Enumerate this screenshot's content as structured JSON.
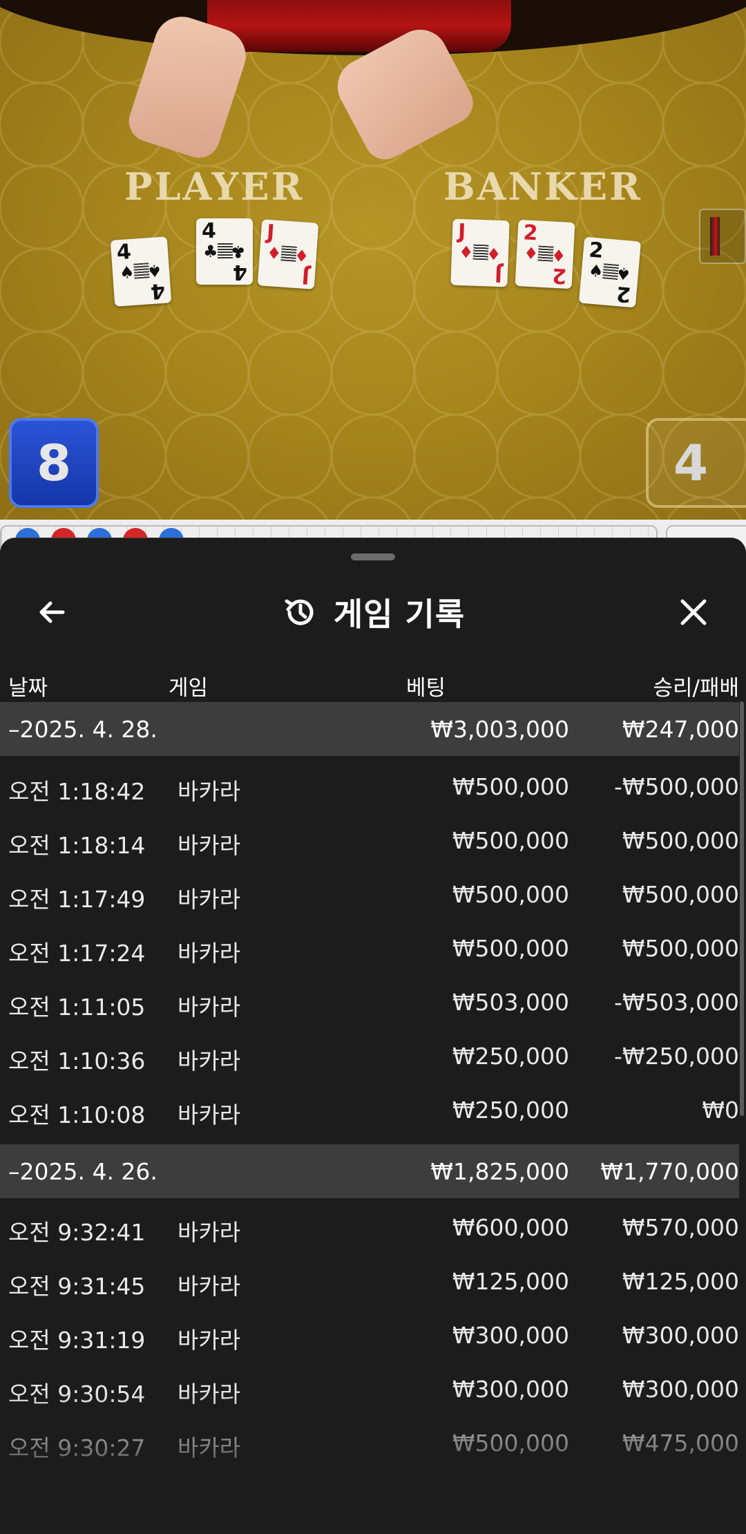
{
  "game_view": {
    "player_label": "PLAYER",
    "banker_label": "BANKER",
    "player_score": "8",
    "banker_score": "4",
    "player_cards": [
      {
        "rank": "4",
        "suit": "♠",
        "color": "black"
      },
      {
        "rank": "4",
        "suit": "♣",
        "color": "black"
      },
      {
        "rank": "J",
        "suit": "♦",
        "color": "red"
      }
    ],
    "banker_cards": [
      {
        "rank": "J",
        "suit": "♦",
        "color": "red"
      },
      {
        "rank": "2",
        "suit": "♦",
        "color": "red"
      },
      {
        "rank": "2",
        "suit": "♠",
        "color": "black"
      }
    ]
  },
  "sheet": {
    "title": "게임 기록",
    "title_icon": "history-icon",
    "back_icon": "arrow-left-icon",
    "close_icon": "close-icon",
    "columns": {
      "date": "날짜",
      "game": "게임",
      "bet": "베팅",
      "result": "승리/패배"
    },
    "groups": [
      {
        "date": "–2025. 4. 28.",
        "bet": "₩3,003,000",
        "result": "₩247,000",
        "rows": [
          {
            "time": "오전 1:18:42",
            "game": "바카라",
            "bet": "₩500,000",
            "result": "-₩500,000"
          },
          {
            "time": "오전 1:18:14",
            "game": "바카라",
            "bet": "₩500,000",
            "result": "₩500,000"
          },
          {
            "time": "오전 1:17:49",
            "game": "바카라",
            "bet": "₩500,000",
            "result": "₩500,000"
          },
          {
            "time": "오전 1:17:24",
            "game": "바카라",
            "bet": "₩500,000",
            "result": "₩500,000"
          },
          {
            "time": "오전 1:11:05",
            "game": "바카라",
            "bet": "₩503,000",
            "result": "-₩503,000"
          },
          {
            "time": "오전 1:10:36",
            "game": "바카라",
            "bet": "₩250,000",
            "result": "-₩250,000"
          },
          {
            "time": "오전 1:10:08",
            "game": "바카라",
            "bet": "₩250,000",
            "result": "₩0"
          }
        ]
      },
      {
        "date": "–2025. 4. 26.",
        "bet": "₩1,825,000",
        "result": "₩1,770,000",
        "rows": [
          {
            "time": "오전 9:32:41",
            "game": "바카라",
            "bet": "₩600,000",
            "result": "₩570,000"
          },
          {
            "time": "오전 9:31:45",
            "game": "바카라",
            "bet": "₩125,000",
            "result": "₩125,000"
          },
          {
            "time": "오전 9:31:19",
            "game": "바카라",
            "bet": "₩300,000",
            "result": "₩300,000"
          },
          {
            "time": "오전 9:30:54",
            "game": "바카라",
            "bet": "₩300,000",
            "result": "₩300,000"
          },
          {
            "time": "오전 9:30:27",
            "game": "바카라",
            "bet": "₩500,000",
            "result": "₩475,000"
          }
        ]
      }
    ]
  },
  "colors": {
    "sheet_bg": "#1c1c1c",
    "group_bg": "#3d3d3d",
    "player_blue": "#1436a8",
    "table_gold": "#a7861d"
  }
}
